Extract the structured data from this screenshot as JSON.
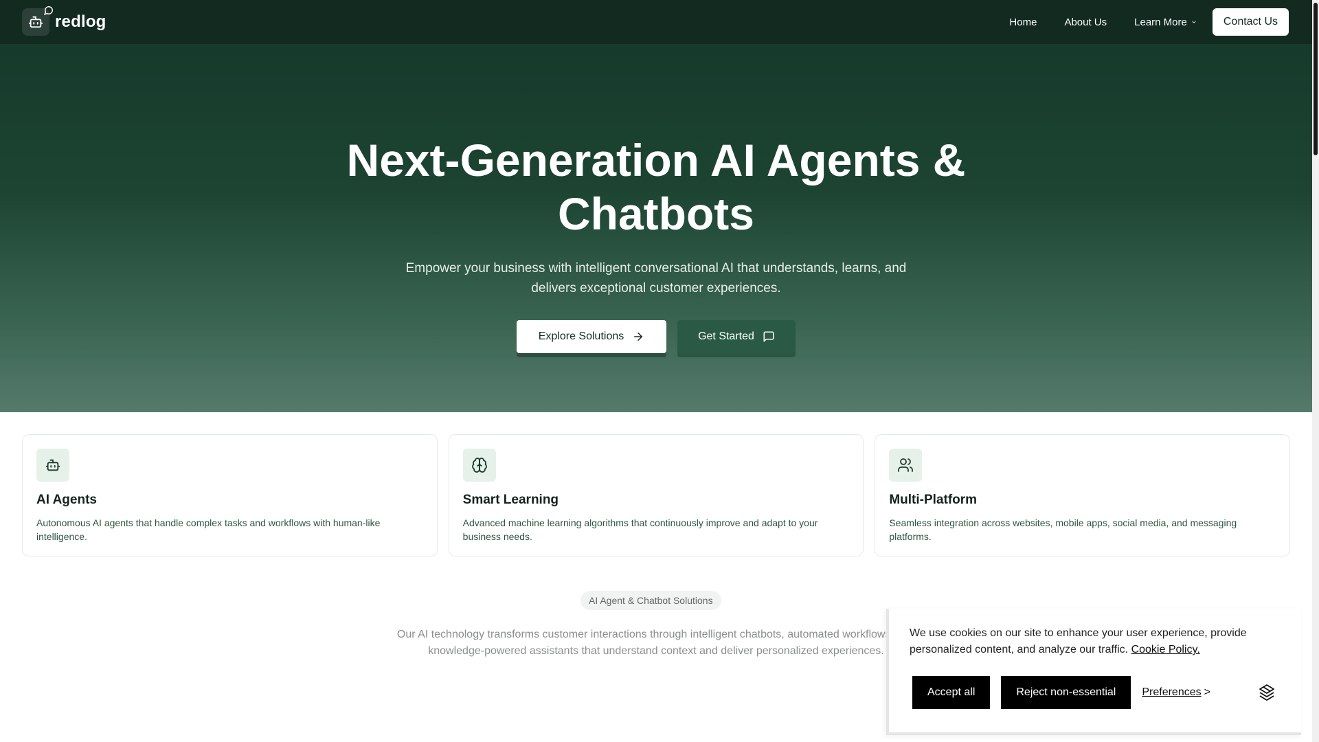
{
  "nav": {
    "brand": "redlog",
    "links": [
      "Home",
      "About Us",
      "Learn More"
    ],
    "contact": "Contact Us"
  },
  "hero": {
    "title_line1": "Next-Generation AI Agents &",
    "title_line2": "Chatbots",
    "subtitle_line1": "Empower your business with intelligent conversational AI that understands, learns, and",
    "subtitle_line2": "delivers exceptional customer experiences.",
    "primary_button": "Explore Solutions",
    "secondary_button": "Get Started"
  },
  "features": [
    {
      "icon": "bot-icon",
      "title": "AI Agents",
      "description": "Autonomous AI agents that handle complex tasks and workflows with human-like intelligence."
    },
    {
      "icon": "brain-icon",
      "title": "Smart Learning",
      "description": "Advanced machine learning algorithms that continuously improve and adapt to your business needs."
    },
    {
      "icon": "users-icon",
      "title": "Multi-Platform",
      "description": "Seamless integration across websites, mobile apps, social media, and messaging platforms."
    }
  ],
  "solutions": {
    "badge": "AI Agent & Chatbot Solutions",
    "text": "Our AI technology transforms customer interactions through intelligent chatbots, automated workflows, and knowledge-powered assistants that understand context and deliver personalized experiences."
  },
  "cookie": {
    "text": "We use cookies on our site to enhance your user experience, provide personalized content, and analyze our traffic.",
    "policy_link": "Cookie Policy.",
    "accept": "Accept all",
    "reject": "Reject non-essential",
    "preferences": "Preferences",
    "preferences_arrow": ">"
  },
  "colors": {
    "nav_bg": "#132a21",
    "hero_top": "#163a2b",
    "hero_bottom": "#557a6b",
    "accent_green": "#2a5a45",
    "card_icon_bg": "#e6f1ea"
  }
}
